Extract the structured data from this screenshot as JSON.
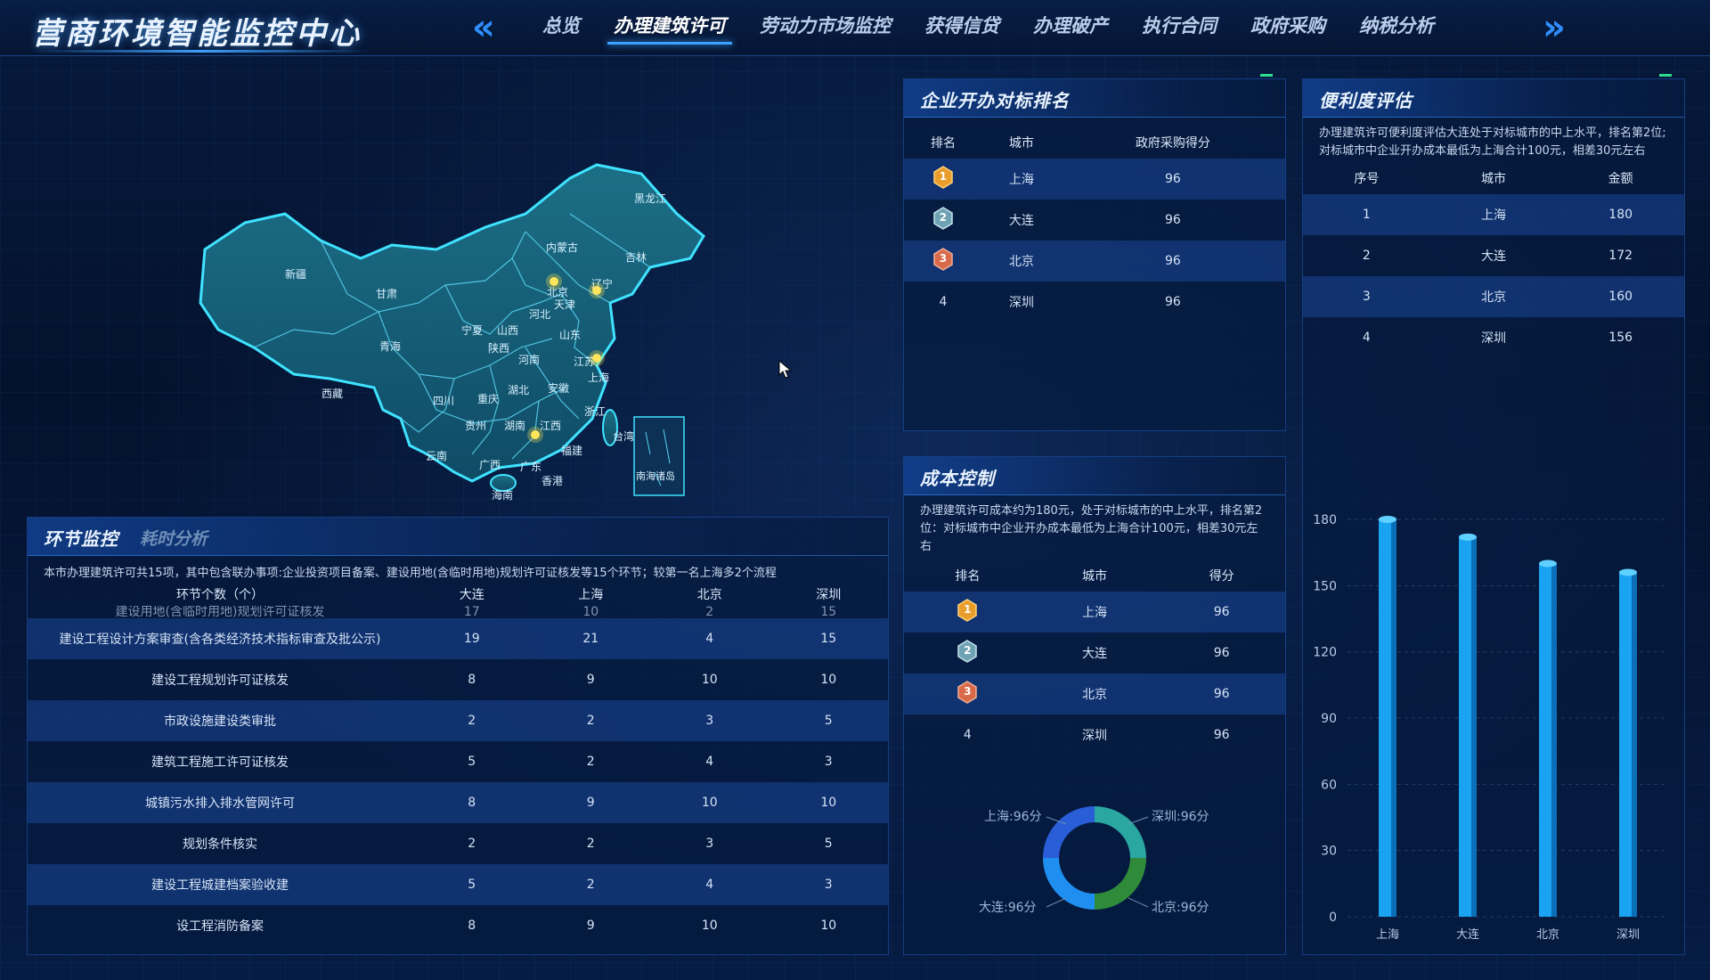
{
  "header": {
    "title": "营商环境智能监控中心",
    "nav_prev": "«",
    "nav_next": "»",
    "tabs": [
      {
        "label": "总览"
      },
      {
        "label": "办理建筑许可",
        "active": true
      },
      {
        "label": "劳动力市场监控"
      },
      {
        "label": "获得信贷"
      },
      {
        "label": "办理破产"
      },
      {
        "label": "执行合同"
      },
      {
        "label": "政府采购"
      },
      {
        "label": "纳税分析"
      }
    ]
  },
  "map": {
    "provinces": [
      "黑龙江",
      "吉林",
      "辽宁",
      "内蒙古",
      "新疆",
      "甘肃",
      "青海",
      "西藏",
      "四川",
      "重庆",
      "云南",
      "贵州",
      "广西",
      "广东",
      "湖南",
      "湖北",
      "江西",
      "福建",
      "浙江",
      "安徽",
      "江苏",
      "山东",
      "河南",
      "河北",
      "山西",
      "陕西",
      "宁夏",
      "天津",
      "北京",
      "上海",
      "台湾",
      "香港",
      "海南",
      "南海诸岛"
    ],
    "marked_cities": [
      "北京",
      "大连",
      "上海",
      "深圳"
    ]
  },
  "procedure": {
    "title": "环节监控",
    "subtitle": "耗时分析",
    "description": "本市办理建筑许可共15项，其中包含联办事项:企业投资项目备案、建设用地(含临时用地)规划许可证核发等15个环节；较第一名上海多2个流程",
    "columns": [
      "环节个数（个）",
      "大连",
      "上海",
      "北京",
      "深圳"
    ],
    "partial_row": [
      "建设用地(含临时用地)规划许可证核发",
      "17",
      "10",
      "2",
      "15"
    ],
    "rows": [
      [
        "建设工程设计方案审查(含各类经济技术指标审查及批公示)",
        "19",
        "21",
        "4",
        "15"
      ],
      [
        "建设工程规划许可证核发",
        "8",
        "9",
        "10",
        "10"
      ],
      [
        "市政设施建设类审批",
        "2",
        "2",
        "3",
        "5"
      ],
      [
        "建筑工程施工许可证核发",
        "5",
        "2",
        "4",
        "3"
      ],
      [
        "城镇污水排入排水管网许可",
        "8",
        "9",
        "10",
        "10"
      ],
      [
        "规划条件核实",
        "2",
        "2",
        "3",
        "5"
      ],
      [
        "建设工程城建档案验收建",
        "5",
        "2",
        "4",
        "3"
      ],
      [
        "设工程消防备案",
        "8",
        "9",
        "10",
        "10"
      ]
    ]
  },
  "ranking": {
    "title": "企业开办对标排名",
    "columns": [
      "排名",
      "城市",
      "政府采购得分"
    ],
    "rows": [
      {
        "rank": "1",
        "city": "上海",
        "score": "96"
      },
      {
        "rank": "2",
        "city": "大连",
        "score": "96"
      },
      {
        "rank": "3",
        "city": "北京",
        "score": "96"
      },
      {
        "rank": "4",
        "city": "深圳",
        "score": "96"
      }
    ]
  },
  "cost": {
    "title": "成本控制",
    "description": "办理建筑许可成本约为180元，处于对标城市的中上水平，排名第2位：对标城市中企业开办成本最低为上海合计100元，相差30元左右",
    "columns": [
      "排名",
      "城市",
      "得分"
    ],
    "rows": [
      {
        "rank": "1",
        "city": "上海",
        "score": "96"
      },
      {
        "rank": "2",
        "city": "大连",
        "score": "96"
      },
      {
        "rank": "3",
        "city": "北京",
        "score": "96"
      },
      {
        "rank": "4",
        "city": "深圳",
        "score": "96"
      }
    ],
    "donut_labels": [
      "上海:96分",
      "深圳:96分",
      "大连:96分",
      "北京:96分"
    ]
  },
  "convenience": {
    "title": "便利度评估",
    "description": "办理建筑许可便利度评估大连处于对标城市的中上水平，排名第2位;对标城市中企业开办成本最低为上海合计100元，相差30元左右",
    "columns": [
      "序号",
      "城市",
      "金额"
    ],
    "rows": [
      {
        "index": "1",
        "city": "上海",
        "amount": "180"
      },
      {
        "index": "2",
        "city": "大连",
        "amount": "172"
      },
      {
        "index": "3",
        "city": "北京",
        "amount": "160"
      },
      {
        "index": "4",
        "city": "深圳",
        "amount": "156"
      }
    ]
  },
  "chart_data": [
    {
      "type": "bar",
      "categories": [
        "上海",
        "大连",
        "北京",
        "深圳"
      ],
      "values": [
        180,
        172,
        160,
        156
      ],
      "ylim": [
        0,
        180
      ],
      "yticks": [
        0,
        30,
        60,
        90,
        120,
        150,
        180
      ],
      "grid": true,
      "bar_color": "#1aa3f0"
    },
    {
      "type": "pie",
      "categories": [
        "上海",
        "深圳",
        "北京",
        "大连"
      ],
      "values": [
        96,
        96,
        96,
        96
      ],
      "colors": [
        "#2aa7a0",
        "#2f8a3a",
        "#1e8ef0",
        "#2a5ed8"
      ]
    }
  ]
}
